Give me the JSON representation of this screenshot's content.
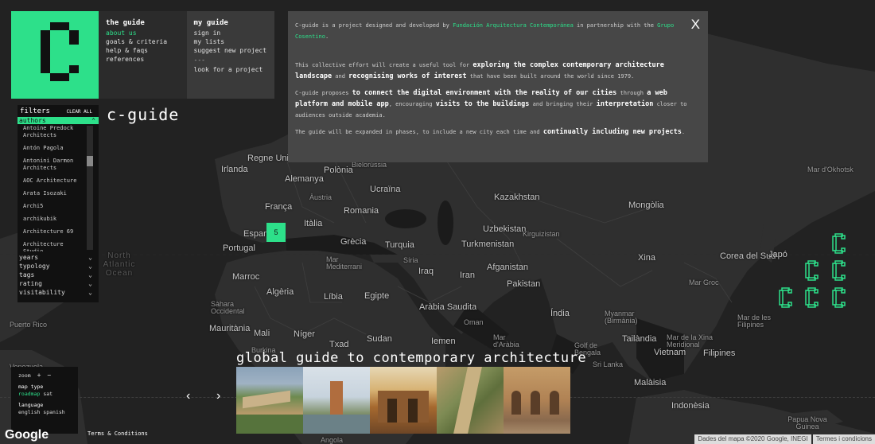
{
  "menu": {
    "guide_col": {
      "title": "the guide",
      "items": [
        "about us",
        "goals & criteria",
        "help & faqs",
        "references"
      ]
    },
    "my_col": {
      "title": "my guide",
      "items": [
        "sign in",
        "my lists",
        "suggest new project"
      ],
      "separator": "---",
      "look": "look for a project"
    }
  },
  "brand": "c-guide",
  "filters": {
    "title": "filters",
    "clear": "CLEAR ALL",
    "authors_label": "authors",
    "authors": [
      "Antoine Predock Architects",
      "Antón Pagola",
      "Antonini Darmon Architects",
      "AOC Architecture",
      "Arata Isozaki",
      "Archi5",
      "archikubik",
      "Architecture 69",
      "Architecture Studio"
    ],
    "groups": [
      "years",
      "typology",
      "tags",
      "rating",
      "visitability"
    ]
  },
  "info": {
    "p1_a": "C-guide is a project designed and developed by ",
    "p1_link1": "Fundación Arquitectura Contemporánea",
    "p1_b": " in partnership with the ",
    "p1_link2": "Grupo Cosentino",
    "p1_c": ".",
    "p2_a": "This collective effort will create a useful tool for ",
    "p2_b1": "exploring the complex contemporary architecture landscape",
    "p2_c": " and ",
    "p2_b2": "recognising works of interest",
    "p2_d": " that have been built around the world since 1979.",
    "p3_a": "C-guide proposes ",
    "p3_b1": "to connect the digital environment with the reality of our cities",
    "p3_c": " through ",
    "p3_b2": "a web platform and mobile app",
    "p3_d": ", encouraging ",
    "p3_b3": "visits to the buildings",
    "p3_e": " and bringing their ",
    "p3_b4": "interpretation",
    "p3_f": " closer to audiences outside academia.",
    "p4_a": "The guide will be expanded in phases, to include a new city each time and ",
    "p4_b": "continually including new projects",
    "p4_c": ".",
    "close": "X"
  },
  "marker_count": "5",
  "tagline": "global guide to contemporary architecture",
  "controls": {
    "zoom_label": "zoom",
    "zoom_in": "+",
    "zoom_out": "−",
    "map_type_label": "map type",
    "map_type_active": "roadmap",
    "map_type_other": "sat",
    "language_label": "language",
    "language_options": "english spanish"
  },
  "footer": {
    "google": "Google",
    "terms": "Terms & Conditions",
    "map_data": "Dades del mapa ©2020 Google, INEGI",
    "map_terms": "Termes i condicions"
  },
  "arrows": {
    "prev": "‹",
    "next": "›"
  },
  "map_labels": {
    "regne_unit": "Regne Unit",
    "irlanda": "Irlanda",
    "polonia": "Polònia",
    "bielorussia": "Bielorússia",
    "alemanya": "Alemanya",
    "ucraina": "Ucraïna",
    "franca": "França",
    "austria": "Àustria",
    "romania": "Romania",
    "italia": "Itàlia",
    "espanya": "Espany",
    "portugal": "Portugal",
    "grecia": "Grècia",
    "turquia": "Turquia",
    "kazakhstan": "Kazakhstan",
    "mongolia": "Mongòlia",
    "uzbekistan": "Uzbekistan",
    "turkmenistan": "Turkmenistan",
    "kirguizistan": "Kirguizistan",
    "siria": "Síria",
    "iraq": "Iraq",
    "iran": "Iran",
    "afganistan": "Afganistan",
    "pakistan": "Pakistan",
    "xina": "Xina",
    "corea": "Corea del Sud",
    "japo": "Japó",
    "india": "Índia",
    "marroc": "Marroc",
    "algeria": "Algèria",
    "libia": "Líbia",
    "egipte": "Egipte",
    "arabia": "Aràbia Saudita",
    "oman": "Oman",
    "iemen": "Iemen",
    "sahara": "Sàhara Occidental",
    "mauritania": "Mauritània",
    "mali": "Mali",
    "niger": "Níger",
    "txad": "Txad",
    "sudan": "Sudan",
    "myanmar": "Myanmar (Birmània)",
    "tailandia": "Tailàndia",
    "vietnam": "Vietnam",
    "filipines": "Filipines",
    "malaisia": "Malàisia",
    "indonesia": "Indonèsia",
    "papua": "Papua Nova Guinea",
    "puerto_rico": "Puerto Rico",
    "venezuela": "Venezuela",
    "north_atlantic": "North Atlantic Ocean",
    "mar_okhotsk": "Mar d'Okhotsk",
    "mar_groc": "Mar Groc",
    "mar_filipines": "Mar de les Filipines",
    "mar_xina": "Mar de la Xina Meridional",
    "golf_bengala": "Golf de Bengala",
    "mar_arabia": "Mar d'Aràbia",
    "mar_mediterrani": "Mar Mediterrani",
    "burkina": "Burkina",
    "angola": "Angola",
    "sri_lanka": "Sri Lanka"
  }
}
